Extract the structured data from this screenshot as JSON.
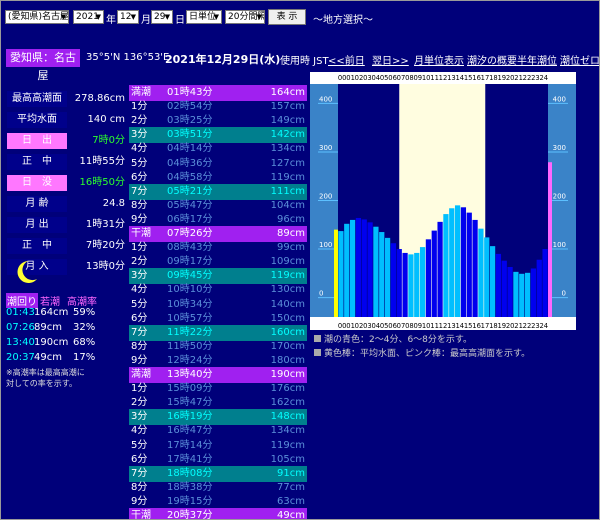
{
  "controls": {
    "location": "(愛知県)名古屋",
    "year": "2021",
    "year_unit": "年",
    "month": "12",
    "month_unit": "月",
    "day": "29",
    "day_unit": "日",
    "mode": "日単位",
    "interval": "20分間隔",
    "show_button": "表 示",
    "region_link": "～地方選択～"
  },
  "header": {
    "location": "愛知県：名古屋",
    "coords": "35°5'N 136°53'E",
    "date": "2021年12月29日(水)",
    "timezone": "使用時 JST",
    "links": [
      "<<前日",
      "翌日>>",
      "月単位表示",
      "潮汐の概要",
      "半年潮位",
      "潮位ゼロ"
    ]
  },
  "stats": [
    {
      "label": "最高高潮面",
      "value": "278.86cm",
      "highlight": false
    },
    {
      "label": "平均水面",
      "value": "140 cm",
      "highlight": false
    },
    {
      "label": "日　出",
      "value": "7時0分",
      "highlight": true
    },
    {
      "label": "正　中",
      "value": "11時55分",
      "highlight": false
    },
    {
      "label": "日　没",
      "value": "16時50分",
      "highlight": true
    },
    {
      "label": "月 齢",
      "value": "24.8",
      "highlight": false
    },
    {
      "label": "月 出",
      "value": "1時31分",
      "highlight": false
    },
    {
      "label": "正　中",
      "value": "7時20分",
      "highlight": false
    },
    {
      "label": "月 入",
      "value": "13時0分",
      "highlight": false
    }
  ],
  "moon_icon": "crescent-moon",
  "peaks": {
    "headers": [
      "潮回り",
      "若潮",
      "高潮率"
    ],
    "rows": [
      {
        "time": "01:43",
        "level": "164cm",
        "rate": "59%"
      },
      {
        "time": "07:26",
        "level": "89cm",
        "rate": "32%"
      },
      {
        "time": "13:40",
        "level": "190cm",
        "rate": "68%"
      },
      {
        "time": "20:37",
        "level": "49cm",
        "rate": "17%"
      }
    ],
    "note": [
      "※高潮率は最高高潮に",
      "対しての率を示す。"
    ]
  },
  "tide_rows": [
    {
      "label": "満潮",
      "time": "01時43分",
      "level": "164cm",
      "kind": "peak"
    },
    {
      "label": "1分",
      "time": "02時54分",
      "level": "157cm",
      "kind": ""
    },
    {
      "label": "2分",
      "time": "03時25分",
      "level": "149cm",
      "kind": ""
    },
    {
      "label": "3分",
      "time": "03時51分",
      "level": "142cm",
      "kind": "teal"
    },
    {
      "label": "4分",
      "time": "04時14分",
      "level": "134cm",
      "kind": ""
    },
    {
      "label": "5分",
      "time": "04時36分",
      "level": "127cm",
      "kind": ""
    },
    {
      "label": "6分",
      "time": "04時58分",
      "level": "119cm",
      "kind": ""
    },
    {
      "label": "7分",
      "time": "05時21分",
      "level": "111cm",
      "kind": "teal"
    },
    {
      "label": "8分",
      "time": "05時47分",
      "level": "104cm",
      "kind": ""
    },
    {
      "label": "9分",
      "time": "06時17分",
      "level": "96cm",
      "kind": ""
    },
    {
      "label": "干潮",
      "time": "07時26分",
      "level": "89cm",
      "kind": "peak"
    },
    {
      "label": "1分",
      "time": "08時43分",
      "level": "99cm",
      "kind": ""
    },
    {
      "label": "2分",
      "time": "09時17分",
      "level": "109cm",
      "kind": ""
    },
    {
      "label": "3分",
      "time": "09時45分",
      "level": "119cm",
      "kind": "teal"
    },
    {
      "label": "4分",
      "time": "10時10分",
      "level": "130cm",
      "kind": ""
    },
    {
      "label": "5分",
      "time": "10時34分",
      "level": "140cm",
      "kind": ""
    },
    {
      "label": "6分",
      "time": "10時57分",
      "level": "150cm",
      "kind": ""
    },
    {
      "label": "7分",
      "time": "11時22分",
      "level": "160cm",
      "kind": "teal"
    },
    {
      "label": "8分",
      "time": "11時50分",
      "level": "170cm",
      "kind": ""
    },
    {
      "label": "9分",
      "time": "12時24分",
      "level": "180cm",
      "kind": ""
    },
    {
      "label": "満潮",
      "time": "13時40分",
      "level": "190cm",
      "kind": "peak"
    },
    {
      "label": "1分",
      "time": "15時09分",
      "level": "176cm",
      "kind": ""
    },
    {
      "label": "2分",
      "time": "15時47分",
      "level": "162cm",
      "kind": ""
    },
    {
      "label": "3分",
      "time": "16時19分",
      "level": "148cm",
      "kind": "teal"
    },
    {
      "label": "4分",
      "time": "16時47分",
      "level": "134cm",
      "kind": ""
    },
    {
      "label": "5分",
      "time": "17時14分",
      "level": "119cm",
      "kind": ""
    },
    {
      "label": "6分",
      "time": "17時41分",
      "level": "105cm",
      "kind": ""
    },
    {
      "label": "7分",
      "time": "18時08分",
      "level": "91cm",
      "kind": "teal"
    },
    {
      "label": "8分",
      "time": "18時38分",
      "level": "77cm",
      "kind": ""
    },
    {
      "label": "9分",
      "time": "19時15分",
      "level": "63cm",
      "kind": ""
    },
    {
      "label": "干潮",
      "time": "20時37分",
      "level": "49cm",
      "kind": "peak"
    }
  ],
  "chart_data": {
    "type": "bar",
    "hours": [
      "00",
      "01",
      "02",
      "03",
      "04",
      "05",
      "06",
      "07",
      "08",
      "09",
      "10",
      "11",
      "12",
      "13",
      "14",
      "15",
      "16",
      "17",
      "18",
      "19",
      "20",
      "21",
      "22",
      "23",
      "24"
    ],
    "y_ticks": [
      0,
      100,
      200,
      300,
      400
    ],
    "ylim": [
      -40,
      440
    ],
    "daylight": [
      7.0,
      16.83
    ],
    "max_level": 278.86,
    "mean_level": 140,
    "levels": [
      137,
      152,
      160,
      164,
      161,
      155,
      146,
      135,
      123,
      112,
      100,
      92,
      89,
      92,
      104,
      120,
      138,
      156,
      172,
      184,
      190,
      186,
      175,
      160,
      142,
      124,
      106,
      90,
      76,
      63,
      53,
      49,
      51,
      60,
      78,
      100
    ]
  },
  "colors": {
    "background": "#00007a",
    "peak_row": "#a020f0",
    "teal_row": "#007f8e",
    "highlight_label": "#ff77ff",
    "bar_light": "#00bfff",
    "bar_dark": "#0000ee",
    "daylight": "#fffde0",
    "yellow_bar": "#ffff00",
    "pink_bar": "#ff66ff"
  },
  "legend": [
    "潮の青色：2～4分、6～8分を示す。",
    "黄色棒：平均水面、ピンク棒：最高高潮面を示す。"
  ]
}
